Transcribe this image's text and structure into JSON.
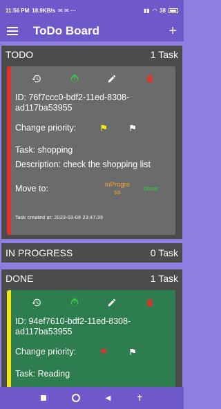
{
  "status_bar": {
    "time": "11:56 PM",
    "speed": "18.9KB/s",
    "battery": "38"
  },
  "app": {
    "title": "ToDo Board"
  },
  "sections": {
    "todo": {
      "title": "TODO",
      "count": "1 Task"
    },
    "in_progress": {
      "title": "IN PROGRESS",
      "count": "0 Task"
    },
    "done": {
      "title": "DONE",
      "count": "1 Task"
    }
  },
  "todo_card": {
    "id_label": "ID: 76f7ccc0-bdf2-11ed-8308-ad117ba53955",
    "change_priority_label": "Change priority:",
    "task_label": "Task: shopping",
    "description_label": "Description:  check the shopping list",
    "move_to_label": "Move to:",
    "move_inprogress": "InProgre ss",
    "move_done": "done",
    "created_label": "Task created at:   2023-03-08 23:47:39",
    "accent_color": "#e0342b",
    "card_color": "#6b6b6b"
  },
  "done_card": {
    "id_label": "ID: 94ef7610-bdf2-11ed-8308-ad117ba53955",
    "change_priority_label": "Change priority:",
    "task_label": "Task: Reading",
    "accent_color": "#f2e418",
    "card_color": "#2e7d4f"
  },
  "colors": {
    "app_bar": "#6f58c9",
    "background": "#8f7ee0",
    "section": "#4b4b4b",
    "history_icon": "#ffffff",
    "timer_icon": "#2ecc40",
    "edit_icon": "#ffffff",
    "delete_icon": "#e0342b",
    "flag_yellow": "#f2e418",
    "flag_red": "#e0342b",
    "flag_white": "#ffffff",
    "inprogress_text": "#f5a623",
    "done_text": "#2ecc40"
  }
}
